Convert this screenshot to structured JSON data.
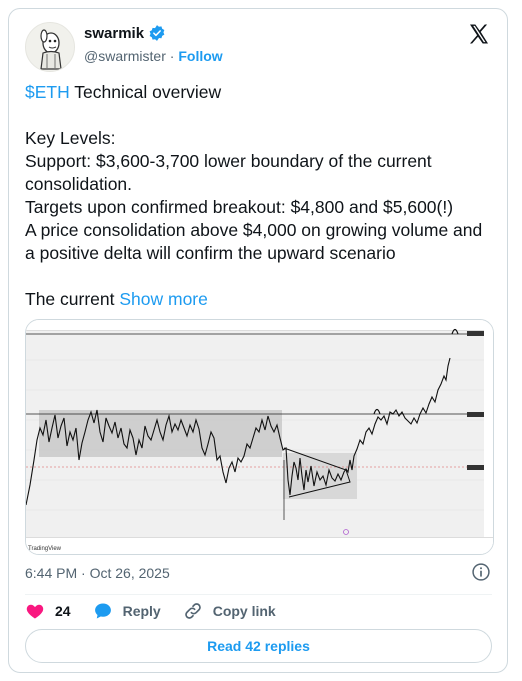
{
  "author": {
    "display_name": "swarmik",
    "handle": "@swarmister",
    "separator": "·",
    "follow_label": "Follow"
  },
  "tweet": {
    "cashtag": "$ETH",
    "text_main": " Technical overview\n\nKey Levels:\nSupport: $3,600-3,700 lower boundary of the current consolidation.\nTargets upon confirmed breakout: $4,800 and $5,600(!)\nA price consolidation above $4,000 on growing volume and a positive delta will confirm the upward scenario\n\nThe current ",
    "show_more": "Show more"
  },
  "chart_image": {
    "watermark": "TradingView",
    "colors": {
      "rectangle": "#c9c9c9",
      "candle": "#111111",
      "background": "#f0f0f0"
    }
  },
  "meta": {
    "timestamp": "6:44 PM · Oct 26, 2025"
  },
  "actions": {
    "likes": "24",
    "reply_label": "Reply",
    "copy_link_label": "Copy link"
  },
  "footer": {
    "read_replies_label": "Read 42 replies"
  },
  "colors": {
    "accent": "#1d9bf0",
    "like": "#f91880",
    "text": "#0f1419",
    "secondary": "#536471"
  },
  "icons": [
    "verified-badge-icon",
    "x-logo-icon",
    "info-icon",
    "heart-icon",
    "reply-icon",
    "link-icon"
  ]
}
